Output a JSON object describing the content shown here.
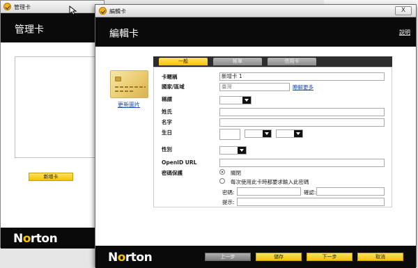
{
  "back_window": {
    "title": "管理卡",
    "header_title": "管理卡",
    "add_card_button": "新增卡",
    "logo_text_before": "N",
    "logo_text_o": "o",
    "logo_text_after": "rton"
  },
  "dialog": {
    "title": "編輯卡",
    "close_label": "X",
    "header_title": "編輯卡",
    "help_link": "說明",
    "update_image_link": "更新圖片",
    "tabs": [
      {
        "label": "一般",
        "active": true
      },
      {
        "label": "帳單",
        "active": false
      },
      {
        "label": "信用卡",
        "active": false
      }
    ],
    "form": {
      "card_name_label": "卡暱稱",
      "card_name_value": "新增卡 1",
      "country_label": "國家/區域",
      "country_value": "臺灣",
      "learn_more_link": "瞭解更多",
      "title_label": "稱謂",
      "last_name_label": "姓氏",
      "first_name_label": "名字",
      "birthday_label": "生日",
      "gender_label": "性別",
      "openid_label": "OpenID URL",
      "password_protect_label": "密碼保護",
      "option_off": "關閉",
      "option_ask": "每次使用此卡時都要求輸入此密碼",
      "password_label": "密碼:",
      "confirm_label": "確認:",
      "hint_label": "提示:"
    },
    "buttons": {
      "back": "上一步",
      "save": "儲存",
      "next": "下一步",
      "cancel": "取消"
    },
    "logo_text_before": "N",
    "logo_text_o": "o",
    "logo_text_after": "rton"
  },
  "colors": {
    "accent_yellow": "#f5c400",
    "header_black": "#0a0a0a",
    "link_blue": "#1c4aa8"
  }
}
